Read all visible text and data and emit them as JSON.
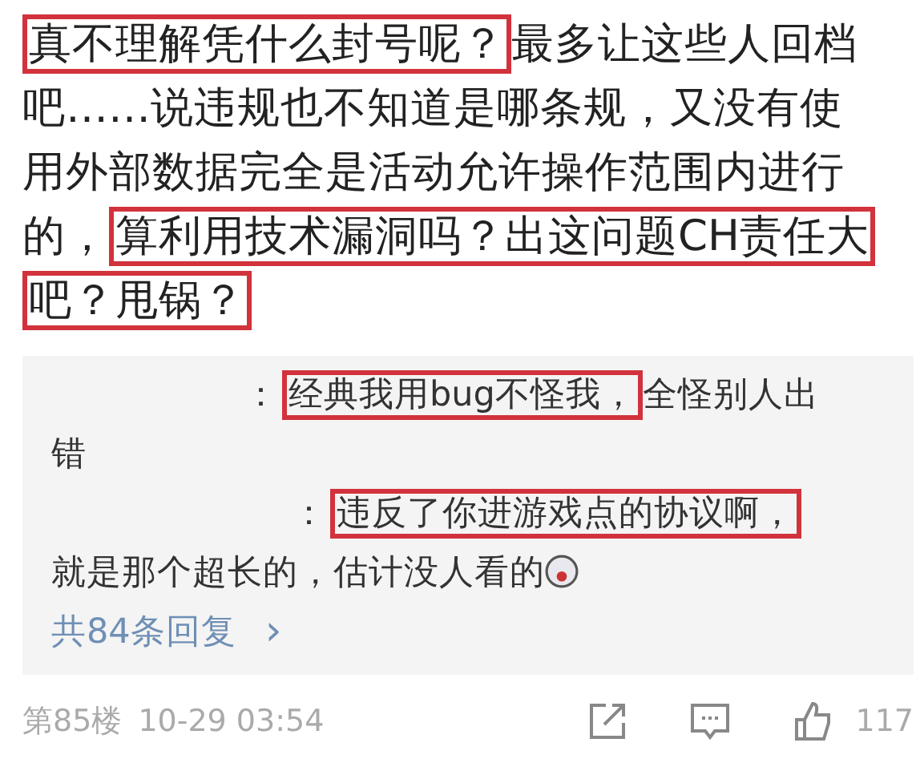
{
  "post": {
    "lines": [
      {
        "segments": [
          {
            "text": "真不理解凭什么封号呢？",
            "highlighted": true
          },
          {
            "text": "最多让这些人回档",
            "highlighted": false
          }
        ]
      },
      {
        "segments": [
          {
            "text": "吧……说违规也不知道是哪条规，又没有使",
            "highlighted": false
          }
        ]
      },
      {
        "segments": [
          {
            "text": "用外部数据完全是活动允许操作范围内进行",
            "highlighted": false
          }
        ]
      },
      {
        "segments": [
          {
            "text": "的，",
            "highlighted": false
          },
          {
            "text": "算利用技术漏洞吗？出这问题CH责任大",
            "highlighted": true
          }
        ]
      },
      {
        "segments": [
          {
            "text": "吧？甩锅？",
            "highlighted": true
          }
        ]
      }
    ]
  },
  "replies": {
    "items": [
      {
        "separator": "：",
        "lines": [
          {
            "segments": [
              {
                "text": "经典我用bug不怪我，",
                "highlighted": true
              },
              {
                "text": "全怪别人出",
                "highlighted": false
              }
            ]
          },
          {
            "segments": [
              {
                "text": "错",
                "highlighted": false
              }
            ]
          }
        ],
        "emoji": false
      },
      {
        "separator": "：",
        "lines": [
          {
            "segments": [
              {
                "text": "违反了你进游戏点的协议啊，",
                "highlighted": true
              }
            ]
          },
          {
            "segments": [
              {
                "text": "就是那个超长的，估计没人看的",
                "highlighted": false
              }
            ]
          }
        ],
        "emoji": true
      }
    ],
    "more_link": "共84条回复",
    "more_arrow": "›"
  },
  "footer": {
    "floor": "第85楼",
    "time": "10-29 03:54",
    "likes": "117"
  }
}
